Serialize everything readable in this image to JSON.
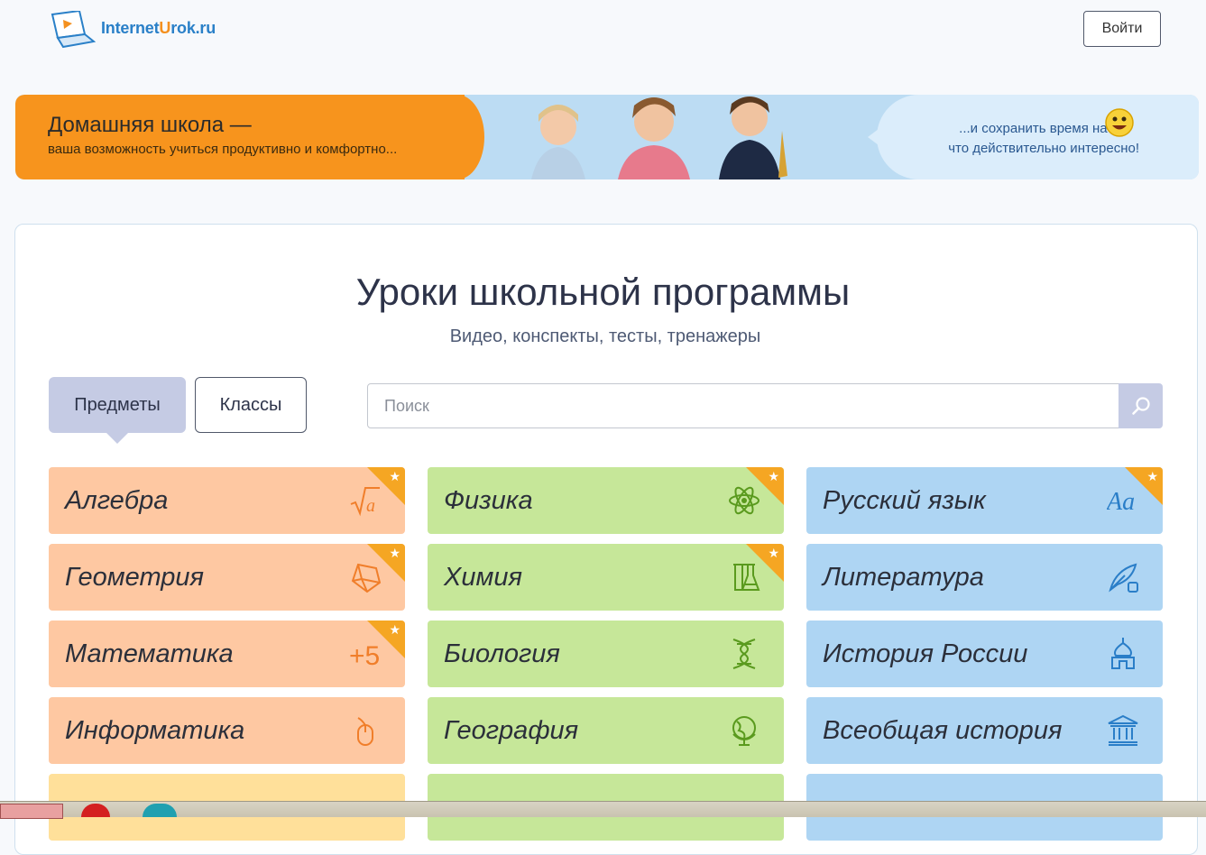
{
  "header": {
    "logo_part1": "Internet",
    "logo_part2": "U",
    "logo_part3": "rok.ru",
    "login_label": "Войти"
  },
  "banner": {
    "title": "Домашняя школа —",
    "subtitle": "ваша возможность учиться продуктивно и комфортно...",
    "bubble_line1": "...и сохранить время на то,",
    "bubble_line2": "что действительно интересно!"
  },
  "main": {
    "title": "Уроки школьной программы",
    "subtitle": "Видео, конспекты, тесты, тренажеры",
    "tabs": [
      {
        "label": "Предметы",
        "active": true
      },
      {
        "label": "Классы",
        "active": false
      }
    ],
    "search": {
      "placeholder": "Поиск",
      "value": ""
    }
  },
  "subjects": {
    "col1": [
      {
        "label": "Алгебра",
        "icon": "sqrt-icon",
        "starred": true
      },
      {
        "label": "Геометрия",
        "icon": "polyhedron-icon",
        "starred": true
      },
      {
        "label": "Математика",
        "icon": "plus-five-icon",
        "starred": true
      },
      {
        "label": "Информатика",
        "icon": "mouse-icon",
        "starred": false
      }
    ],
    "col2": [
      {
        "label": "Физика",
        "icon": "atom-icon",
        "starred": true
      },
      {
        "label": "Химия",
        "icon": "flask-icon",
        "starred": true
      },
      {
        "label": "Биология",
        "icon": "dna-icon",
        "starred": false
      },
      {
        "label": "География",
        "icon": "globe-icon",
        "starred": false
      }
    ],
    "col3": [
      {
        "label": "Русский язык",
        "icon": "letters-aa-icon",
        "starred": true
      },
      {
        "label": "Литература",
        "icon": "quill-icon",
        "starred": false
      },
      {
        "label": "История России",
        "icon": "church-dome-icon",
        "starred": false
      },
      {
        "label": "Всеобщая история",
        "icon": "museum-icon",
        "starred": false
      }
    ]
  },
  "colors": {
    "math": "#fec8a2",
    "science": "#c6e799",
    "humanities": "#aed5f3",
    "star": "#f5a623",
    "math_icon": "#f07e2a",
    "science_icon": "#5a9a1e",
    "humanities_icon": "#2a7ec8"
  }
}
